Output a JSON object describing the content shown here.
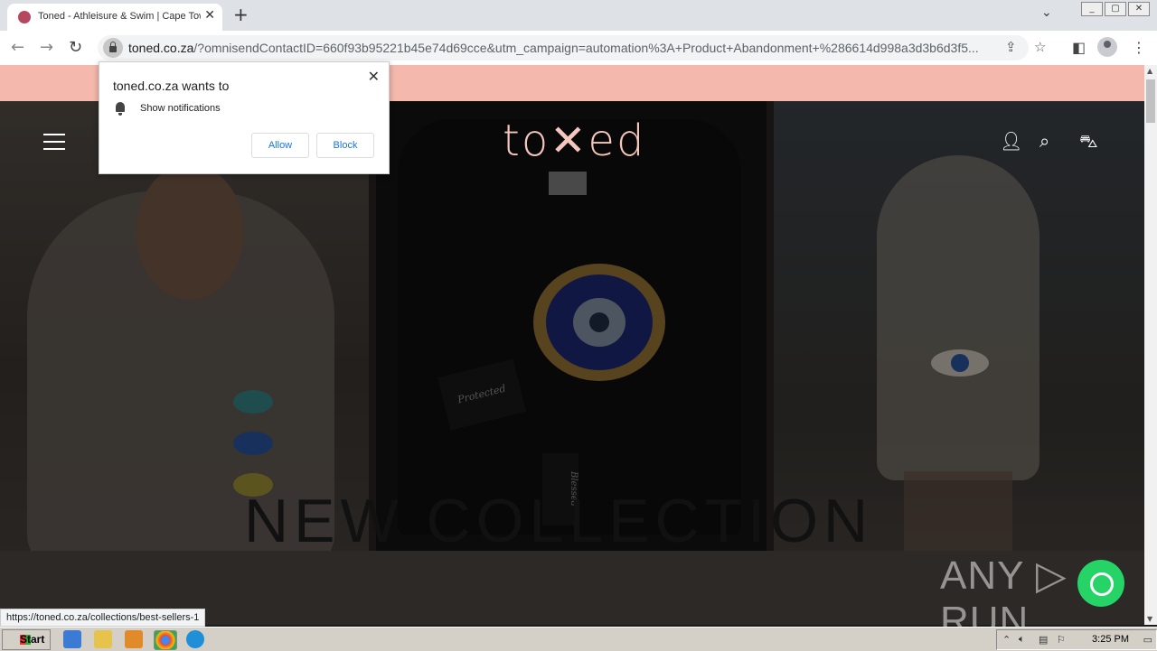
{
  "browser": {
    "tab_title": "Toned - Athleisure & Swim | Cape Town",
    "tab_close": "✕",
    "new_tab": "+",
    "url_host": "toned.co.za",
    "url_path": "/?omnisendContactID=660f93b95221b45e74d69cce&utm_campaign=automation%3A+Product+Abandonment+%286614d998a3d3b6d3f5...",
    "status_url": "https://toned.co.za/collections/best-sellers-1"
  },
  "notification": {
    "title": "toned.co.za wants to",
    "permission": "Show notifications",
    "allow_label": "Allow",
    "block_label": "Block",
    "close": "✕"
  },
  "site": {
    "logo": "to✕ed",
    "hero_title": "NEW COLLECTION",
    "patch_protected": "Protected",
    "patch_blessed": "Blessed",
    "colors": {
      "promo_bar": "#f4b8ad",
      "logo": "#f6c7bc"
    }
  },
  "overlay": {
    "watermark": "ANY ▷ RUN"
  },
  "taskbar": {
    "start_label": "Start",
    "clock": "3:25 PM"
  }
}
